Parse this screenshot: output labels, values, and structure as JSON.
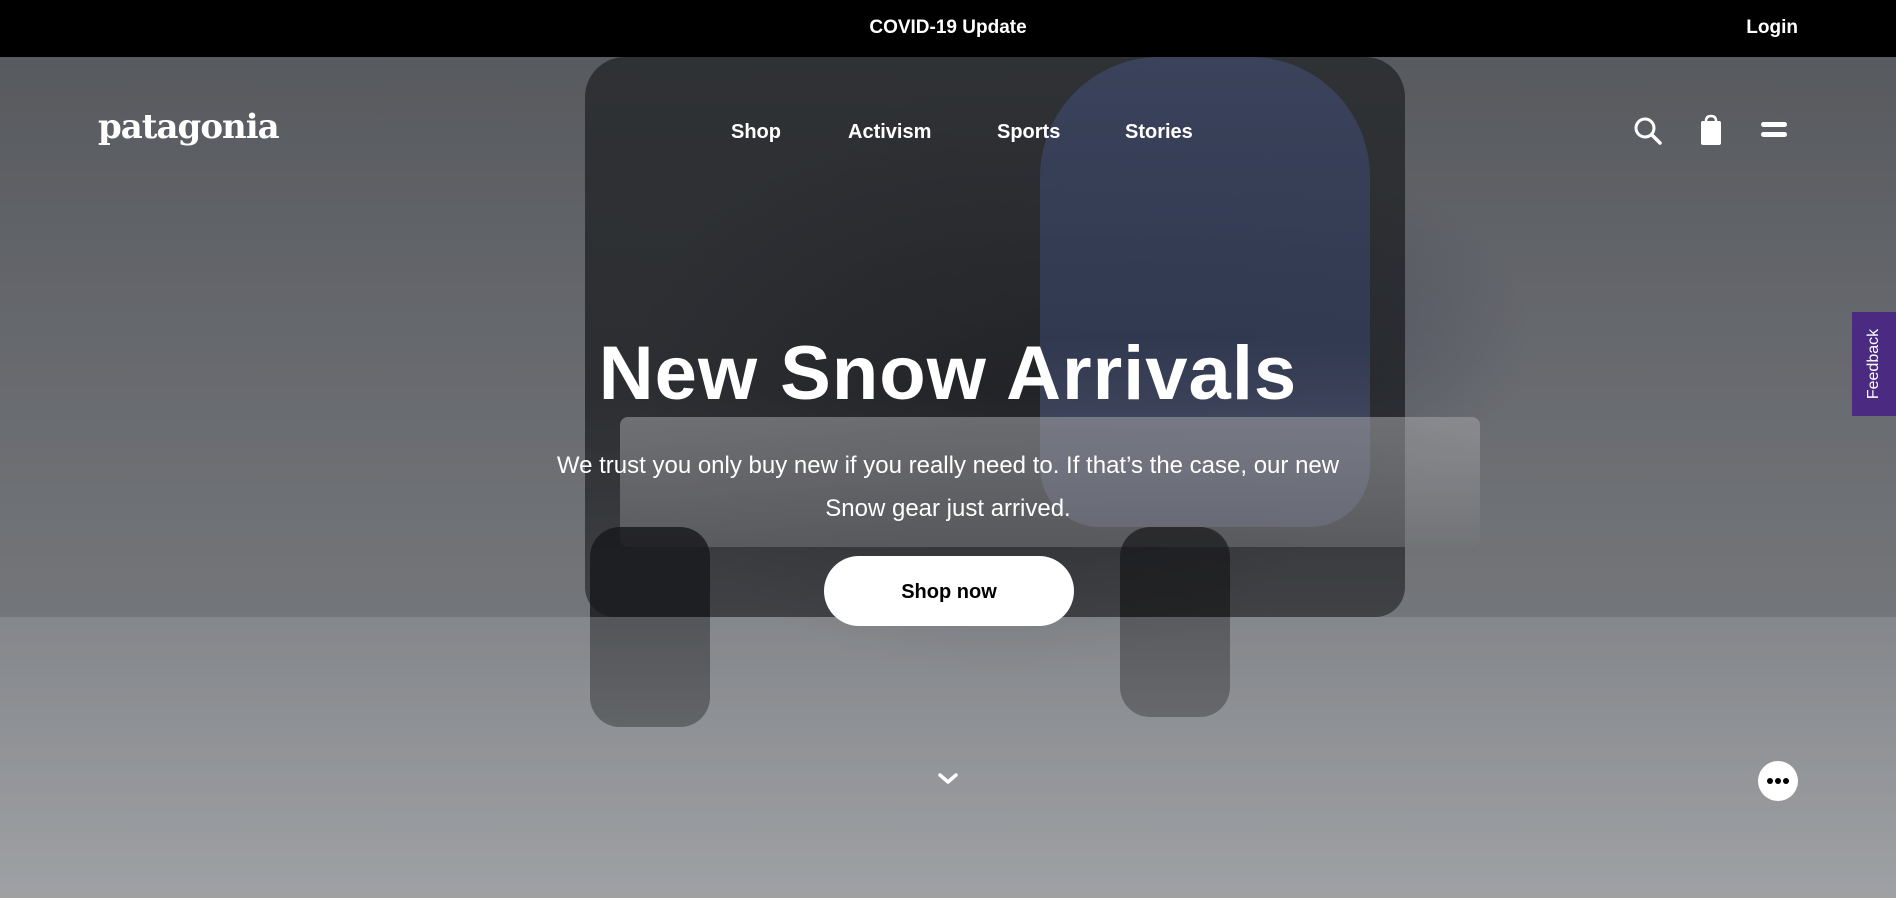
{
  "topbar": {
    "covid": "COVID-19 Update",
    "login": "Login"
  },
  "header": {
    "logo": "patagonia",
    "nav": [
      "Shop",
      "Activism",
      "Sports",
      "Stories"
    ],
    "icons": [
      "search-icon",
      "bag-icon",
      "menu-icon"
    ]
  },
  "hero": {
    "headline": "New Snow Arrivals",
    "subtext_line1": "We trust you only buy new if you really need to. If that’s the case, our new",
    "subtext_line2": "Snow gear just arrived.",
    "cta": "Shop now"
  },
  "feedback": "Feedback",
  "colors": {
    "feedback_bg": "#4b2a82",
    "topbar_bg": "#000000"
  }
}
